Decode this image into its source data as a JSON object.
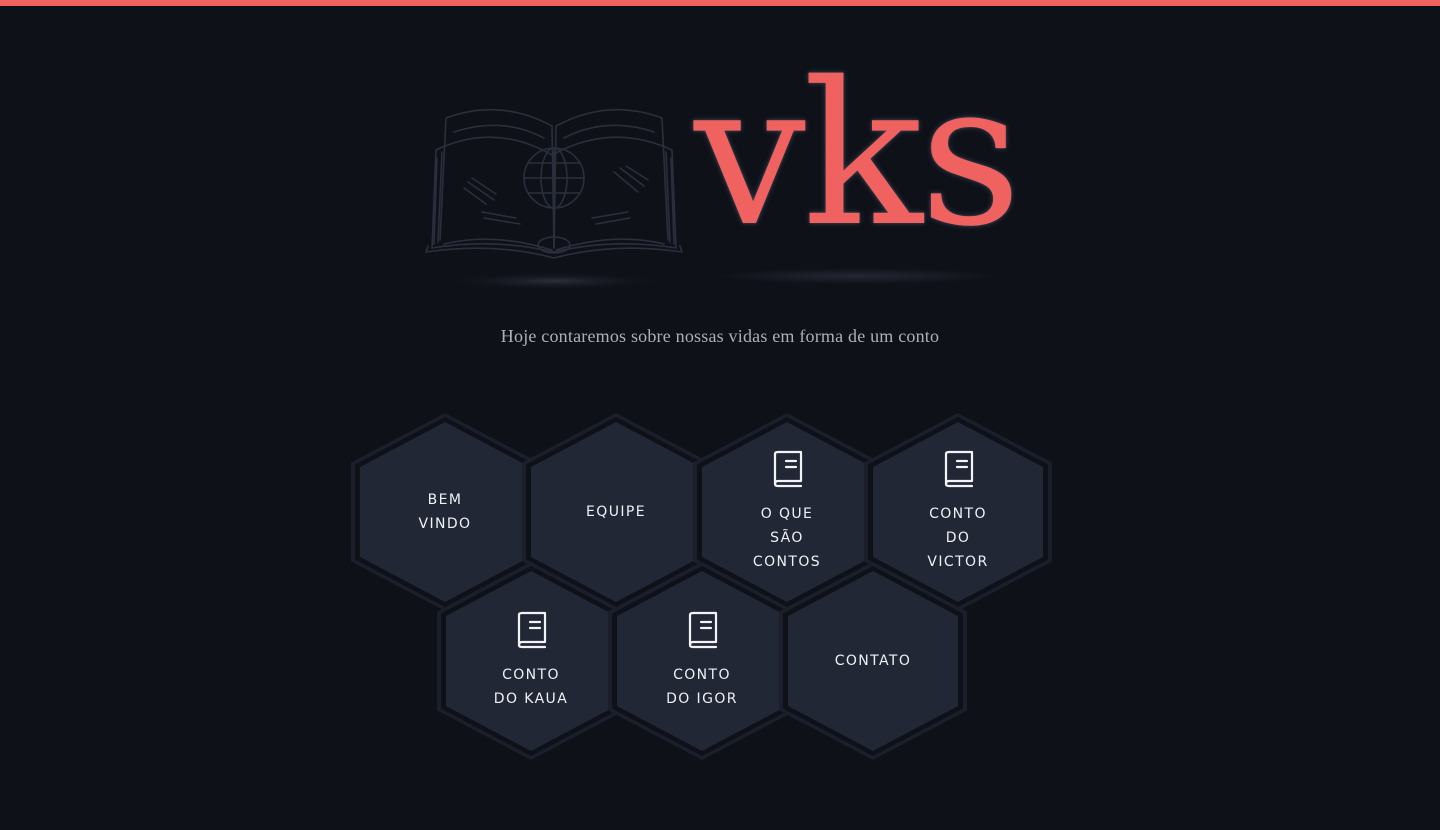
{
  "brand": {
    "name": "vks",
    "accent_color": "#f0625f"
  },
  "tagline": "Hoje contaremos sobre nossas vidas em forma de um conto",
  "nav": {
    "items": [
      {
        "id": "bem-vindo",
        "label_lines": [
          "BEM",
          "VINDO"
        ],
        "icon": null
      },
      {
        "id": "equipe",
        "label_lines": [
          "EQUIPE"
        ],
        "icon": null
      },
      {
        "id": "o-que-sao-contos",
        "label_lines": [
          "O QUE",
          "SÃO",
          "CONTOS"
        ],
        "icon": "book-icon"
      },
      {
        "id": "conto-do-victor",
        "label_lines": [
          "CONTO",
          "DO",
          "VICTOR"
        ],
        "icon": "book-icon"
      },
      {
        "id": "conto-do-kaua",
        "label_lines": [
          "CONTO",
          "DO KAUA"
        ],
        "icon": "book-icon"
      },
      {
        "id": "conto-do-igor",
        "label_lines": [
          "CONTO",
          "DO IGOR"
        ],
        "icon": "book-icon"
      },
      {
        "id": "contato",
        "label_lines": [
          "CONTATO"
        ],
        "icon": null
      }
    ]
  }
}
